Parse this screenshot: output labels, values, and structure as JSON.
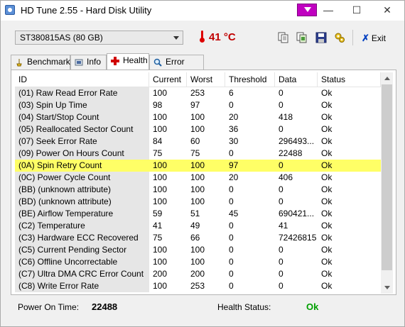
{
  "window": {
    "title": "HD Tune 2.55 - Hard Disk Utility",
    "minimize_glyph": "—",
    "maximize_glyph": "☐",
    "close_glyph": "✕"
  },
  "toolbar": {
    "drive": "ST380815AS (80 GB)",
    "temperature": "41 °C",
    "exit_label": "Exit",
    "exit_glyph": "✗"
  },
  "tabs": [
    {
      "label": "Benchmark",
      "icon": "benchmark-icon"
    },
    {
      "label": "Info",
      "icon": "info-icon"
    },
    {
      "label": "Health",
      "icon": "health-cross-icon"
    },
    {
      "label": "Error Scan",
      "icon": "magnifier-icon"
    }
  ],
  "active_tab": "Health",
  "table": {
    "columns": [
      "ID",
      "Current",
      "Worst",
      "Threshold",
      "Data",
      "Status"
    ],
    "selected_row": 6,
    "rows": [
      {
        "id": "(01) Raw Read Error Rate",
        "current": "100",
        "worst": "253",
        "threshold": "6",
        "data": "0",
        "status": "Ok"
      },
      {
        "id": "(03) Spin Up Time",
        "current": "98",
        "worst": "97",
        "threshold": "0",
        "data": "0",
        "status": "Ok"
      },
      {
        "id": "(04) Start/Stop Count",
        "current": "100",
        "worst": "100",
        "threshold": "20",
        "data": "418",
        "status": "Ok"
      },
      {
        "id": "(05) Reallocated Sector Count",
        "current": "100",
        "worst": "100",
        "threshold": "36",
        "data": "0",
        "status": "Ok"
      },
      {
        "id": "(07) Seek Error Rate",
        "current": "84",
        "worst": "60",
        "threshold": "30",
        "data": "296493...",
        "status": "Ok"
      },
      {
        "id": "(09) Power On Hours Count",
        "current": "75",
        "worst": "75",
        "threshold": "0",
        "data": "22488",
        "status": "Ok"
      },
      {
        "id": "(0A) Spin Retry Count",
        "current": "100",
        "worst": "100",
        "threshold": "97",
        "data": "0",
        "status": "Ok"
      },
      {
        "id": "(0C) Power Cycle Count",
        "current": "100",
        "worst": "100",
        "threshold": "20",
        "data": "406",
        "status": "Ok"
      },
      {
        "id": "(BB) (unknown attribute)",
        "current": "100",
        "worst": "100",
        "threshold": "0",
        "data": "0",
        "status": "Ok"
      },
      {
        "id": "(BD) (unknown attribute)",
        "current": "100",
        "worst": "100",
        "threshold": "0",
        "data": "0",
        "status": "Ok"
      },
      {
        "id": "(BE) Airflow Temperature",
        "current": "59",
        "worst": "51",
        "threshold": "45",
        "data": "690421...",
        "status": "Ok"
      },
      {
        "id": "(C2) Temperature",
        "current": "41",
        "worst": "49",
        "threshold": "0",
        "data": "41",
        "status": "Ok"
      },
      {
        "id": "(C3) Hardware ECC Recovered",
        "current": "75",
        "worst": "66",
        "threshold": "0",
        "data": "72426815",
        "status": "Ok"
      },
      {
        "id": "(C5) Current Pending Sector",
        "current": "100",
        "worst": "100",
        "threshold": "0",
        "data": "0",
        "status": "Ok"
      },
      {
        "id": "(C6) Offline Uncorrectable",
        "current": "100",
        "worst": "100",
        "threshold": "0",
        "data": "0",
        "status": "Ok"
      },
      {
        "id": "(C7) Ultra DMA CRC Error Count",
        "current": "200",
        "worst": "200",
        "threshold": "0",
        "data": "0",
        "status": "Ok"
      },
      {
        "id": "(C8) Write Error Rate",
        "current": "100",
        "worst": "253",
        "threshold": "0",
        "data": "0",
        "status": "Ok"
      }
    ]
  },
  "status_bar": {
    "power_on_label": "Power On Time:",
    "power_on_value": "22488",
    "health_label": "Health Status:",
    "health_value": "Ok"
  },
  "colors": {
    "selected_row": "#ffff66",
    "temperature": "#c00000",
    "health_ok": "#00a000"
  }
}
